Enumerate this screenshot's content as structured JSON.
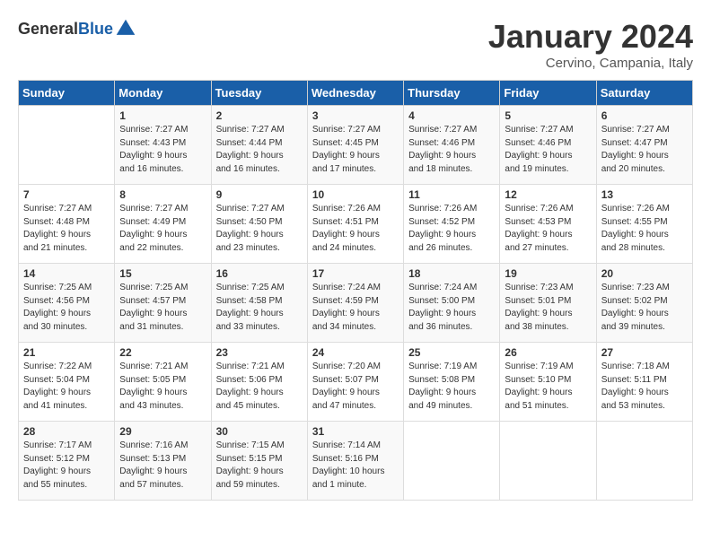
{
  "header": {
    "logo_general": "General",
    "logo_blue": "Blue",
    "title": "January 2024",
    "location": "Cervino, Campania, Italy"
  },
  "days_of_week": [
    "Sunday",
    "Monday",
    "Tuesday",
    "Wednesday",
    "Thursday",
    "Friday",
    "Saturday"
  ],
  "weeks": [
    [
      {
        "day": "",
        "info": ""
      },
      {
        "day": "1",
        "info": "Sunrise: 7:27 AM\nSunset: 4:43 PM\nDaylight: 9 hours\nand 16 minutes."
      },
      {
        "day": "2",
        "info": "Sunrise: 7:27 AM\nSunset: 4:44 PM\nDaylight: 9 hours\nand 16 minutes."
      },
      {
        "day": "3",
        "info": "Sunrise: 7:27 AM\nSunset: 4:45 PM\nDaylight: 9 hours\nand 17 minutes."
      },
      {
        "day": "4",
        "info": "Sunrise: 7:27 AM\nSunset: 4:46 PM\nDaylight: 9 hours\nand 18 minutes."
      },
      {
        "day": "5",
        "info": "Sunrise: 7:27 AM\nSunset: 4:46 PM\nDaylight: 9 hours\nand 19 minutes."
      },
      {
        "day": "6",
        "info": "Sunrise: 7:27 AM\nSunset: 4:47 PM\nDaylight: 9 hours\nand 20 minutes."
      }
    ],
    [
      {
        "day": "7",
        "info": "Sunrise: 7:27 AM\nSunset: 4:48 PM\nDaylight: 9 hours\nand 21 minutes."
      },
      {
        "day": "8",
        "info": "Sunrise: 7:27 AM\nSunset: 4:49 PM\nDaylight: 9 hours\nand 22 minutes."
      },
      {
        "day": "9",
        "info": "Sunrise: 7:27 AM\nSunset: 4:50 PM\nDaylight: 9 hours\nand 23 minutes."
      },
      {
        "day": "10",
        "info": "Sunrise: 7:26 AM\nSunset: 4:51 PM\nDaylight: 9 hours\nand 24 minutes."
      },
      {
        "day": "11",
        "info": "Sunrise: 7:26 AM\nSunset: 4:52 PM\nDaylight: 9 hours\nand 26 minutes."
      },
      {
        "day": "12",
        "info": "Sunrise: 7:26 AM\nSunset: 4:53 PM\nDaylight: 9 hours\nand 27 minutes."
      },
      {
        "day": "13",
        "info": "Sunrise: 7:26 AM\nSunset: 4:55 PM\nDaylight: 9 hours\nand 28 minutes."
      }
    ],
    [
      {
        "day": "14",
        "info": "Sunrise: 7:25 AM\nSunset: 4:56 PM\nDaylight: 9 hours\nand 30 minutes."
      },
      {
        "day": "15",
        "info": "Sunrise: 7:25 AM\nSunset: 4:57 PM\nDaylight: 9 hours\nand 31 minutes."
      },
      {
        "day": "16",
        "info": "Sunrise: 7:25 AM\nSunset: 4:58 PM\nDaylight: 9 hours\nand 33 minutes."
      },
      {
        "day": "17",
        "info": "Sunrise: 7:24 AM\nSunset: 4:59 PM\nDaylight: 9 hours\nand 34 minutes."
      },
      {
        "day": "18",
        "info": "Sunrise: 7:24 AM\nSunset: 5:00 PM\nDaylight: 9 hours\nand 36 minutes."
      },
      {
        "day": "19",
        "info": "Sunrise: 7:23 AM\nSunset: 5:01 PM\nDaylight: 9 hours\nand 38 minutes."
      },
      {
        "day": "20",
        "info": "Sunrise: 7:23 AM\nSunset: 5:02 PM\nDaylight: 9 hours\nand 39 minutes."
      }
    ],
    [
      {
        "day": "21",
        "info": "Sunrise: 7:22 AM\nSunset: 5:04 PM\nDaylight: 9 hours\nand 41 minutes."
      },
      {
        "day": "22",
        "info": "Sunrise: 7:21 AM\nSunset: 5:05 PM\nDaylight: 9 hours\nand 43 minutes."
      },
      {
        "day": "23",
        "info": "Sunrise: 7:21 AM\nSunset: 5:06 PM\nDaylight: 9 hours\nand 45 minutes."
      },
      {
        "day": "24",
        "info": "Sunrise: 7:20 AM\nSunset: 5:07 PM\nDaylight: 9 hours\nand 47 minutes."
      },
      {
        "day": "25",
        "info": "Sunrise: 7:19 AM\nSunset: 5:08 PM\nDaylight: 9 hours\nand 49 minutes."
      },
      {
        "day": "26",
        "info": "Sunrise: 7:19 AM\nSunset: 5:10 PM\nDaylight: 9 hours\nand 51 minutes."
      },
      {
        "day": "27",
        "info": "Sunrise: 7:18 AM\nSunset: 5:11 PM\nDaylight: 9 hours\nand 53 minutes."
      }
    ],
    [
      {
        "day": "28",
        "info": "Sunrise: 7:17 AM\nSunset: 5:12 PM\nDaylight: 9 hours\nand 55 minutes."
      },
      {
        "day": "29",
        "info": "Sunrise: 7:16 AM\nSunset: 5:13 PM\nDaylight: 9 hours\nand 57 minutes."
      },
      {
        "day": "30",
        "info": "Sunrise: 7:15 AM\nSunset: 5:15 PM\nDaylight: 9 hours\nand 59 minutes."
      },
      {
        "day": "31",
        "info": "Sunrise: 7:14 AM\nSunset: 5:16 PM\nDaylight: 10 hours\nand 1 minute."
      },
      {
        "day": "",
        "info": ""
      },
      {
        "day": "",
        "info": ""
      },
      {
        "day": "",
        "info": ""
      }
    ]
  ]
}
